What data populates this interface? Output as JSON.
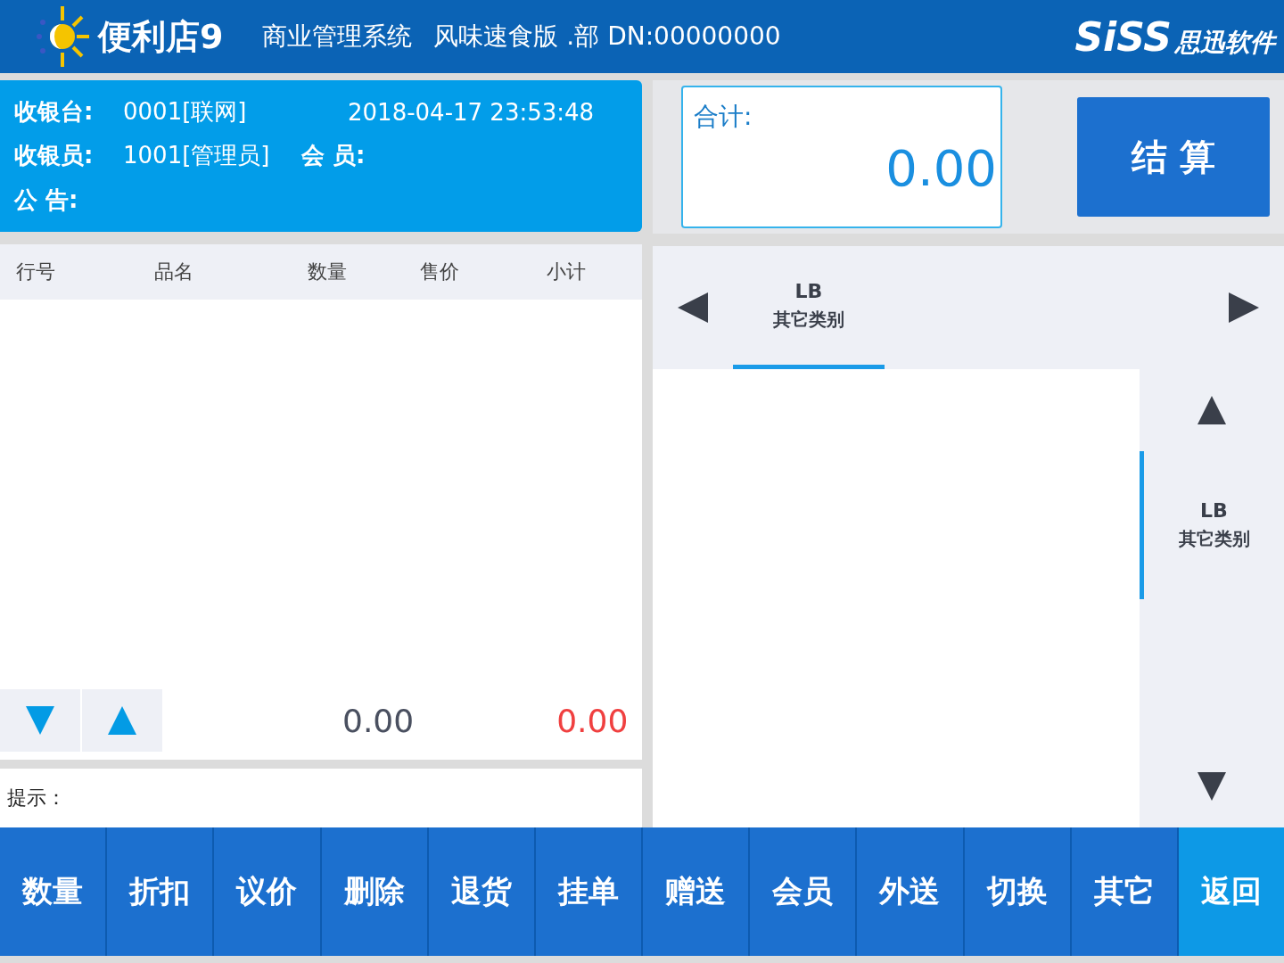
{
  "header": {
    "app_name": "便利店9",
    "system_name": "商业管理系统",
    "edition": "风味速食版 .部 DN:00000000",
    "brand": "SiSS",
    "brand_cn": "思迅软件"
  },
  "info": {
    "register_label": "收银台:",
    "register_value": "0001[联网]",
    "datetime": "2018-04-17  23:53:48",
    "cashier_label": "收银员:",
    "cashier_value": "1001[管理员]",
    "member_label": "会  员:",
    "notice_label": "公  告:"
  },
  "total": {
    "label": "合计:",
    "value": "0.00"
  },
  "settle_button": "结 算",
  "table": {
    "columns": [
      "行号",
      "品名",
      "数量",
      "售价",
      "小计"
    ],
    "quantity_total": "0.00",
    "amount_total": "0.00"
  },
  "hint": {
    "label": "提示："
  },
  "category_tabs": [
    {
      "code": "LB",
      "name": "其它类别",
      "selected": true
    }
  ],
  "subcategories": [
    {
      "code": "LB",
      "name": "其它类别",
      "selected": true
    }
  ],
  "toolbar": [
    {
      "label": "数量",
      "selected": false
    },
    {
      "label": "折扣",
      "selected": false
    },
    {
      "label": "议价",
      "selected": false
    },
    {
      "label": "删除",
      "selected": false
    },
    {
      "label": "退货",
      "selected": false
    },
    {
      "label": "挂单",
      "selected": false
    },
    {
      "label": "赠送",
      "selected": false
    },
    {
      "label": "会员",
      "selected": false
    },
    {
      "label": "外送",
      "selected": false
    },
    {
      "label": "切换",
      "selected": false
    },
    {
      "label": "其它",
      "selected": false
    },
    {
      "label": "返回",
      "selected": true
    }
  ]
}
